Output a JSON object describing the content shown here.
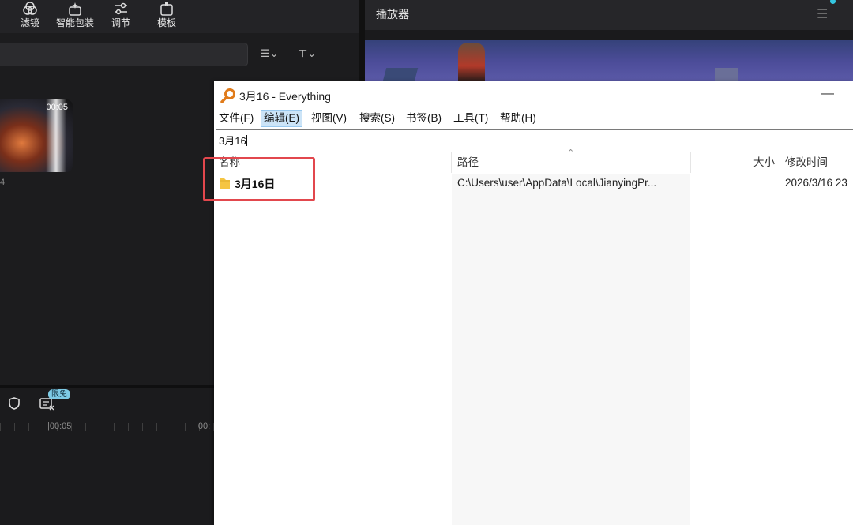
{
  "editor": {
    "toolbar": [
      {
        "label": "滤镜",
        "icon": "filter-effect-icon"
      },
      {
        "label": "智能包装",
        "icon": "smart-pack-icon"
      },
      {
        "label": "调节",
        "icon": "adjust-sliders-icon"
      },
      {
        "label": "模板",
        "icon": "template-icon"
      }
    ],
    "media": {
      "duration": "00:05",
      "caption": "4"
    },
    "timeline": {
      "badge": "限免",
      "ticks": [
        "00:05",
        "00:"
      ]
    }
  },
  "player": {
    "title": "播放器"
  },
  "everything": {
    "title": "3月16 - Everything",
    "minimize": "—",
    "menu": [
      "文件(F)",
      "编辑(E)",
      "视图(V)",
      "搜索(S)",
      "书签(B)",
      "工具(T)",
      "帮助(H)"
    ],
    "active_menu_index": 1,
    "search_value": "3月16",
    "columns": {
      "name": "名称",
      "path": "路径",
      "size": "大小",
      "modified": "修改时间"
    },
    "results": [
      {
        "name": "3月16日",
        "path": "C:\\Users\\user\\AppData\\Local\\JianyingPr...",
        "size": "",
        "modified": "2026/3/16 23"
      }
    ]
  },
  "colors": {
    "highlight": "#e2474d",
    "accent_dot": "#34c6e0"
  }
}
